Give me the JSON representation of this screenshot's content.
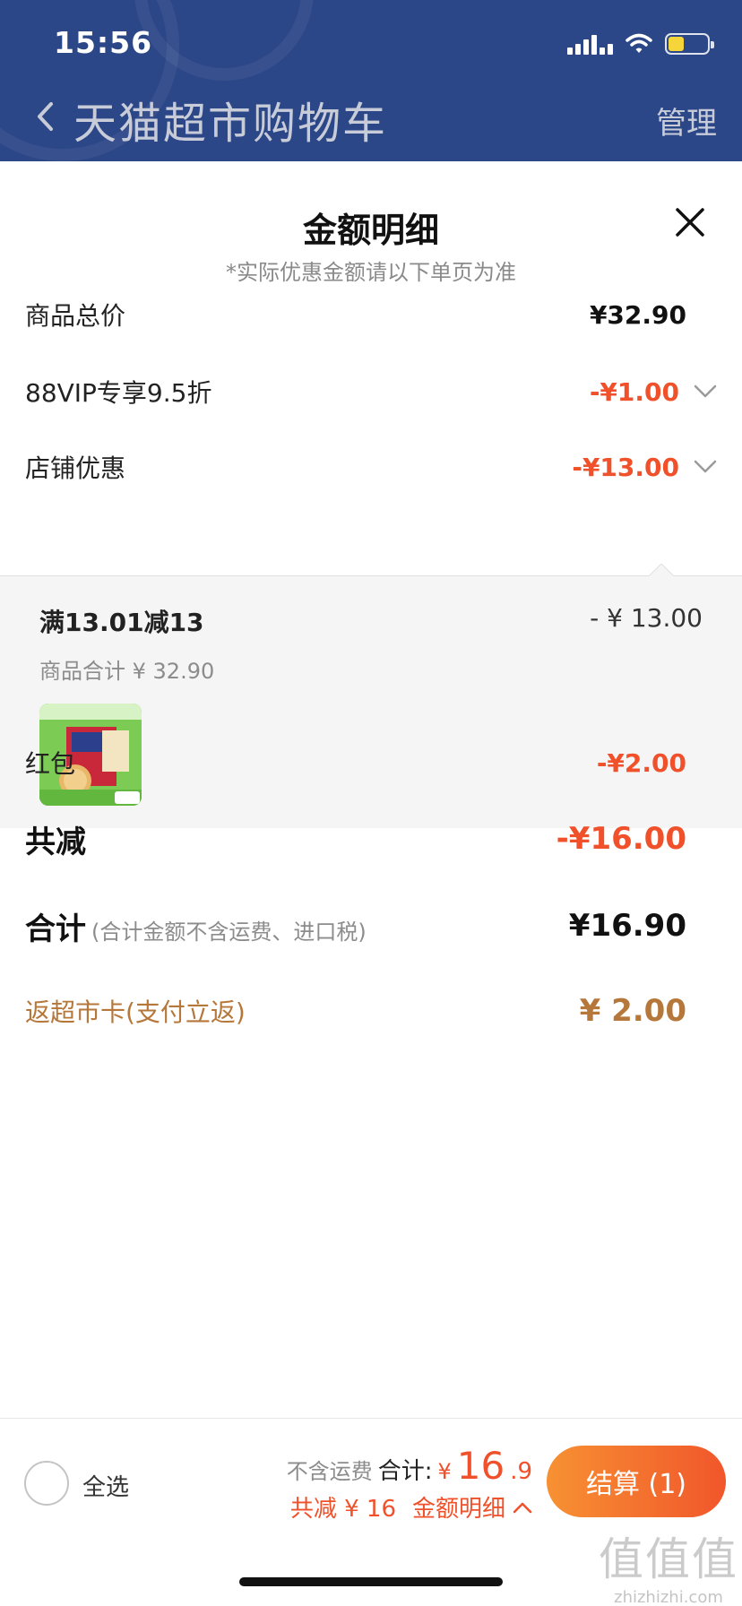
{
  "status_bar": {
    "time": "15:56"
  },
  "nav": {
    "title": "天猫超市购物车",
    "manage_label": "管理"
  },
  "sheet": {
    "title": "金额明细",
    "subtitle": "*实际优惠金额请以下单页为准",
    "rows": {
      "total_goods": {
        "label": "商品总价",
        "value": "¥32.90"
      },
      "vip": {
        "label": "88VIP专享9.5折",
        "value": "-¥1.00"
      },
      "shop": {
        "label": "店铺优惠",
        "value": "-¥13.00"
      },
      "red_packet": {
        "label": "红包",
        "value": "-¥2.00"
      },
      "total_reduce": {
        "label": "共减",
        "value": "-¥16.00"
      },
      "sum": {
        "label": "合计",
        "note": "(合计金额不含运费、进口税)",
        "value": "¥16.90"
      },
      "cashback": {
        "label": "返超市卡(支付立返)",
        "value": "¥ 2.00"
      }
    },
    "coupon": {
      "title": "满13.01减13",
      "amount": "- ¥ 13.00",
      "subtotal": "商品合计 ¥ 32.90"
    }
  },
  "footer": {
    "select_all": "全选",
    "no_shipping": "不含运费",
    "total_label": "合计:",
    "yen": "¥",
    "total_int": "16",
    "total_dec": ".9",
    "reduce": "共减 ¥ 16",
    "detail_link": "金额明细",
    "checkout": "结算 (1)"
  },
  "watermark": {
    "logo": "值值值",
    "url": "zhizhizhi.com"
  },
  "colors": {
    "header_bg": "#2c4787",
    "discount": "#f0502a",
    "cashback": "#b5773a",
    "checkout_start": "#f79133",
    "checkout_end": "#f1562b"
  },
  "icons": [
    "back-chevron-icon",
    "signal-icon",
    "wifi-icon",
    "battery-icon",
    "close-icon",
    "chevron-down-icon",
    "chevron-up-icon"
  ]
}
